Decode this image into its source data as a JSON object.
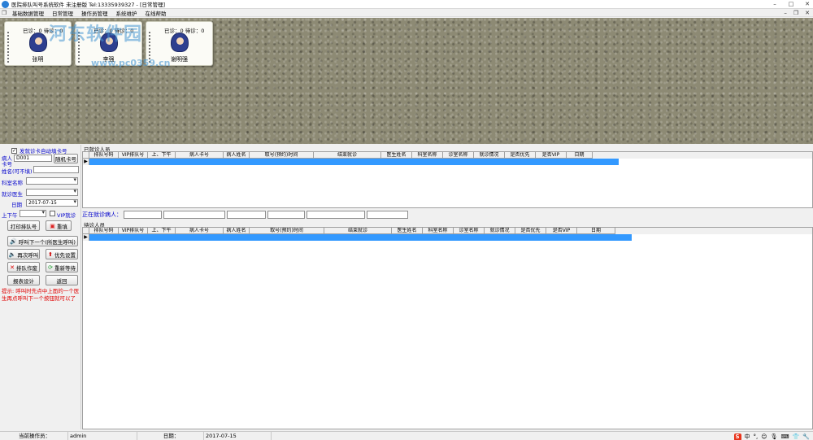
{
  "window": {
    "title": "医院排队叫号系统软件 未注册版 Tel:13335939327 - [日常管理]",
    "controls": {
      "minimize": "–",
      "maximize": "□",
      "close": "✕"
    }
  },
  "menu": {
    "items": [
      "基础数据管理",
      "日常管理",
      "操作员管理",
      "系统维护",
      "在线帮助"
    ],
    "mdi_controls": {
      "minimize": "–",
      "restore": "❐",
      "close": "✕"
    }
  },
  "watermark": {
    "line1": "河东软件园",
    "line2": "www.pc0359.cn"
  },
  "doctors": [
    {
      "stat": "已诊：0 待诊：0",
      "name": "张明"
    },
    {
      "stat": "已诊：0 待诊：0",
      "name": "李强"
    },
    {
      "stat": "已诊：0 待诊：0",
      "name": "谢明强"
    }
  ],
  "form": {
    "auto_card_label": "发就诊卡自动填卡号",
    "auto_card_checked": "✓",
    "card_label_1": "病人",
    "card_label_2": "卡号",
    "card_value": "D001",
    "random_card_button": "随机卡号",
    "name_label": "姓名(可不填)",
    "name_value": "",
    "dept_label": "科室名称",
    "dept_value": "",
    "doctor_label": "就诊医生",
    "doctor_value": "",
    "date_label": "日期",
    "date_value": "2017-07-15",
    "ampm_label": "上下午",
    "ampm_value": "",
    "vip_label": "VIP就诊",
    "print_button": "打印排队号",
    "clear_button": "重填",
    "call_next_button": "呼叫下一个(所医生呼叫)",
    "recall_button": "再次呼叫",
    "priority_button": "优先设置",
    "void_button": "排队作废",
    "requeue_button": "重新等待",
    "report_button": "报表设计",
    "back_button": "返回",
    "tip": "提示: 呼叫时先点中上面的一个医生再点呼叫下一个按钮就可以了"
  },
  "seen": {
    "label": "已就诊人员",
    "headers": [
      "排队号码",
      "VIP排队号",
      "上、下午",
      "病人卡号",
      "病人姓名",
      "取号(预约)时间",
      "结束就诊",
      "医生姓名",
      "科室名称",
      "诊室名称",
      "就诊情况",
      "是否优先",
      "是否VIP",
      "日期"
    ],
    "pointer": "▶"
  },
  "current": {
    "label": "正在就诊病人："
  },
  "waiting": {
    "label": "待诊人员",
    "headers": [
      "排队号码",
      "VIP排队号",
      "上、下午",
      "病人卡号",
      "病人姓名",
      "取号(预约)时间",
      "结束就诊",
      "医生姓名",
      "科室名称",
      "诊室名称",
      "就诊情况",
      "是否优先",
      "是否VIP",
      "日期"
    ],
    "pointer": "▶"
  },
  "statusbar": {
    "operator_label": "当前操作员：",
    "operator_value": "admin",
    "date_label": "日期：",
    "date_value": "2017-07-15",
    "ime": [
      "S",
      "中",
      "°,",
      "☺",
      "🎙",
      "⌨",
      "👕",
      "🔧"
    ]
  },
  "colors": {
    "selection": "#3399ff",
    "label_blue": "#0000cc",
    "tip_red": "#e00000"
  }
}
